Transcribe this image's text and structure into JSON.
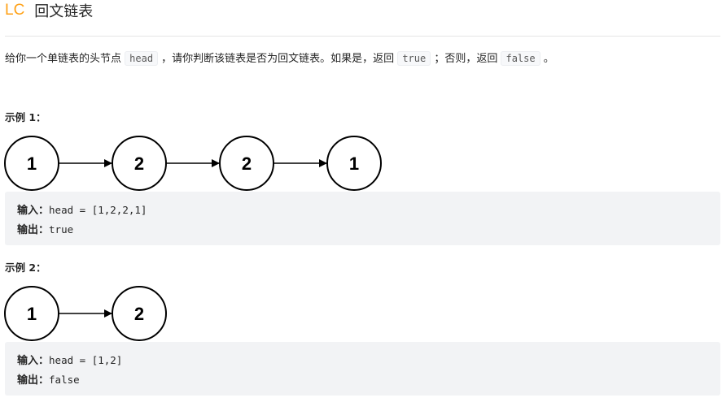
{
  "header": {
    "prefix": "LC",
    "title": "回文链表"
  },
  "description": {
    "part1": "给你一个单链表的头节点 ",
    "code1": "head",
    "part2": " ，请你判断该链表是否为回文链表。如果是，返回 ",
    "code2": "true",
    "part3": " ；否则，返回 ",
    "code3": "false",
    "part4": " 。"
  },
  "examples": [
    {
      "heading": "示例 1：",
      "nodes": [
        "1",
        "2",
        "2",
        "1"
      ],
      "input_label": "输入：",
      "input_value": "head = [1,2,2,1]",
      "output_label": "输出：",
      "output_value": "true"
    },
    {
      "heading": "示例 2：",
      "nodes": [
        "1",
        "2"
      ],
      "input_label": "输入：",
      "input_value": "head = [1,2]",
      "output_label": "输出：",
      "output_value": "false"
    }
  ],
  "colors": {
    "brand": "#ffa116",
    "code_bg": "#f2f3f5"
  }
}
